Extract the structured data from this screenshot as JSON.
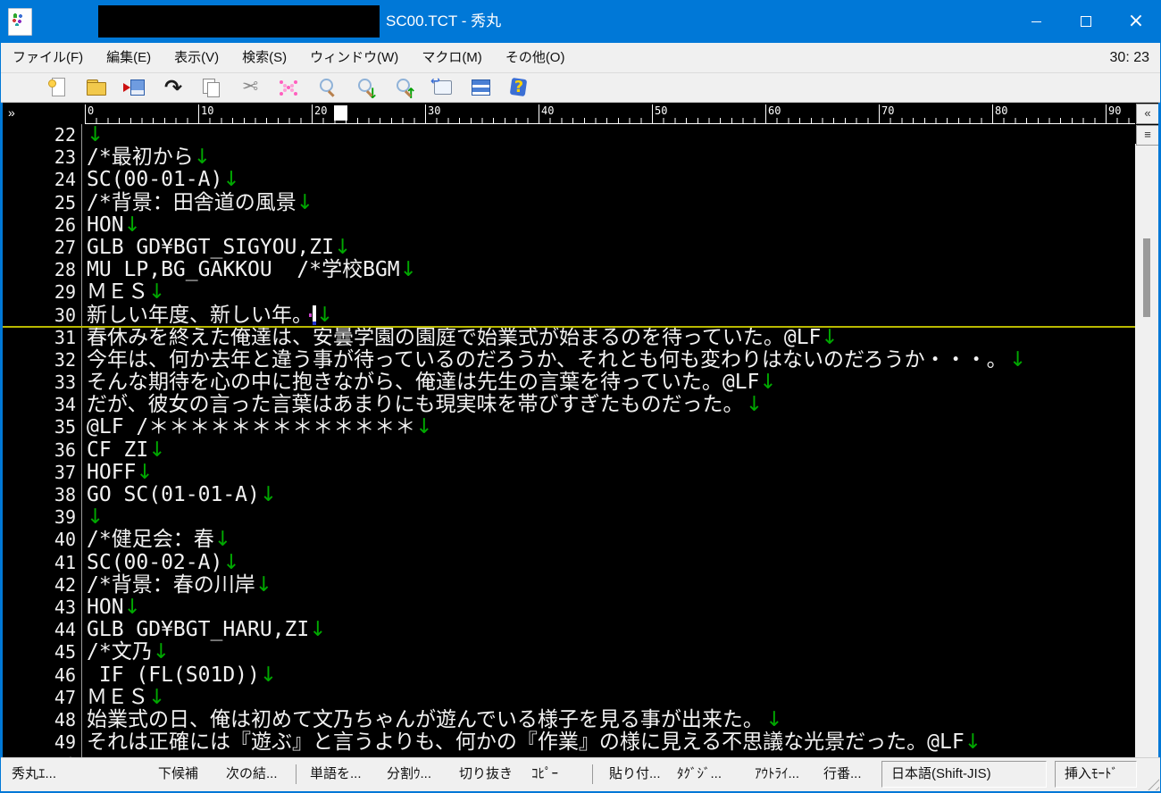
{
  "colors": {
    "titlebar_blue": "#0078d7",
    "editor_bg": "#000000",
    "text": "#f2f2f2",
    "newline_arrow_green": "#00a800",
    "cursor_line_yellow": "#b8b800",
    "chrome_gray": "#f0f0f0"
  },
  "titlebar": {
    "title": "SC00.TCT - 秀丸",
    "controls": [
      "minimize",
      "maximize",
      "close"
    ]
  },
  "menubar": {
    "items": [
      "ファイル(F)",
      "編集(E)",
      "表示(V)",
      "検索(S)",
      "ウィンドウ(W)",
      "マクロ(M)",
      "その他(O)"
    ],
    "position_indicator": "30: 23"
  },
  "toolbar": {
    "icons": [
      {
        "name": "new-file-icon"
      },
      {
        "name": "open-folder-icon"
      },
      {
        "name": "save-icon"
      },
      {
        "name": "undo-icon",
        "glyph": "↶"
      },
      {
        "name": "copy-icon"
      },
      {
        "name": "cut-icon",
        "glyph": "✂"
      },
      {
        "name": "paste-icon"
      },
      {
        "name": "search-icon"
      },
      {
        "name": "search-down-icon",
        "overlay": "↓"
      },
      {
        "name": "search-up-icon",
        "overlay": "↑"
      },
      {
        "name": "tag-jump-icon"
      },
      {
        "name": "split-window-icon"
      },
      {
        "name": "help-icon",
        "glyph": "?"
      }
    ]
  },
  "ruler": {
    "fold_button": "»",
    "unit_numbers": [
      0,
      10,
      20,
      30,
      40,
      50,
      60,
      70,
      80,
      90
    ],
    "cursor_marker_column": 22,
    "collapse_button": "«",
    "list_button": "≡"
  },
  "editor": {
    "lines": [
      {
        "num": 22,
        "text": "",
        "arrow": "half"
      },
      {
        "num": 23,
        "text": "/*最初から",
        "arrow": "half"
      },
      {
        "num": 24,
        "text": "SC(00-01-A)",
        "arrow": "half"
      },
      {
        "num": 25,
        "text": "/*背景：田舎道の風景",
        "arrow": "half"
      },
      {
        "num": 26,
        "text": "HON",
        "arrow": "half"
      },
      {
        "num": 27,
        "text": "GLB GD¥BGT_SIGYOU,ZI",
        "arrow": "half"
      },
      {
        "num": 28,
        "text": "MU LP,BG_GAKKOU  /*学校BGM",
        "arrow": "half"
      },
      {
        "num": 29,
        "text": "ＭＥＳ",
        "arrow": "half"
      },
      {
        "num": 30,
        "text": "新しい年度、新しい年。",
        "arrow": "half",
        "cursor": true,
        "cursor_line": true
      },
      {
        "num": 31,
        "text": "春休みを終えた俺達は、安曇学園の園庭で始業式が始まるのを待っていた。@LF",
        "arrow": "half"
      },
      {
        "num": 32,
        "text": "今年は、何か去年と違う事が待っているのだろうか、それとも何も変わりはないのだろうか・・・。",
        "arrow": "full"
      },
      {
        "num": 33,
        "text": "そんな期待を心の中に抱きながら、俺達は先生の言葉を待っていた。@LF",
        "arrow": "half"
      },
      {
        "num": 34,
        "text": "だが、彼女の言った言葉はあまりにも現実味を帯びすぎたものだった。",
        "arrow": "full"
      },
      {
        "num": 35,
        "text": "@LF /＊＊＊＊＊＊＊＊＊＊＊＊＊",
        "arrow": "half"
      },
      {
        "num": 36,
        "text": "CF ZI",
        "arrow": "half"
      },
      {
        "num": 37,
        "text": "HOFF",
        "arrow": "half"
      },
      {
        "num": 38,
        "text": "GO SC(01-01-A)",
        "arrow": "half"
      },
      {
        "num": 39,
        "text": "",
        "arrow": "half"
      },
      {
        "num": 40,
        "text": "/*健足会：春",
        "arrow": "half"
      },
      {
        "num": 41,
        "text": "SC(00-02-A)",
        "arrow": "half"
      },
      {
        "num": 42,
        "text": "/*背景：春の川岸",
        "arrow": "half"
      },
      {
        "num": 43,
        "text": "HON",
        "arrow": "half"
      },
      {
        "num": 44,
        "text": "GLB GD¥BGT_HARU,ZI",
        "arrow": "half"
      },
      {
        "num": 45,
        "text": "/*文乃",
        "arrow": "half"
      },
      {
        "num": 46,
        "text": " IF (FL(S01D))",
        "arrow": "half"
      },
      {
        "num": 47,
        "text": "ＭＥＳ",
        "arrow": "half"
      },
      {
        "num": 48,
        "text": "始業式の日、俺は初めて文乃ちゃんが遊んでいる様子を見る事が出来た。",
        "arrow": "full"
      },
      {
        "num": 49,
        "text": "それは正確には『遊ぶ』と言うよりも、何かの『作業』の様に見える不思議な光景だった。@LF",
        "arrow": "half"
      },
      {
        "num": 50,
        "text": "",
        "arrow": null
      }
    ]
  },
  "statusbar": {
    "cells": [
      "秀丸ｴ...",
      "下候補",
      "次の結...",
      "単語を...",
      "分割ｳ...",
      "切り抜き",
      "ｺﾋﾟｰ",
      "貼り付...",
      "ﾀｸﾞｼﾞ...",
      "ｱｳﾄﾗｲ...",
      "行番..."
    ],
    "encoding": "日本語(Shift-JIS)",
    "input_mode": "挿入ﾓｰﾄﾞ"
  }
}
